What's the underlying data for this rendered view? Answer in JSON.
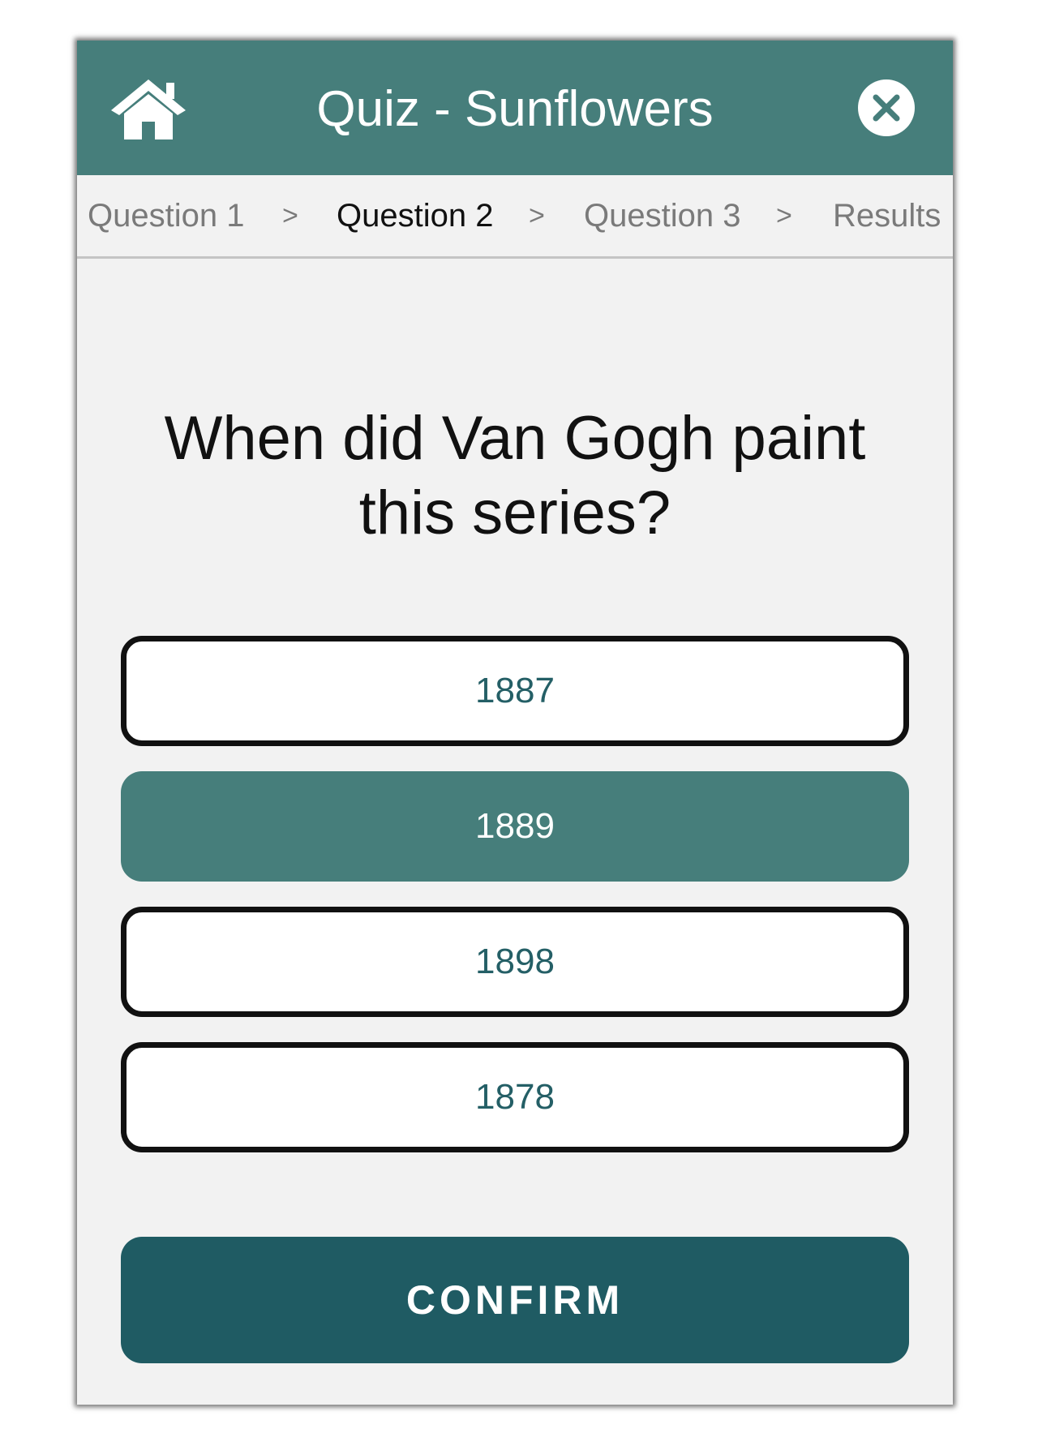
{
  "header": {
    "title": "Quiz - Sunflowers",
    "home_icon": "home-icon",
    "close_icon": "close-icon"
  },
  "steps": [
    {
      "label": "Question 1",
      "state": "done"
    },
    {
      "label": "Question 2",
      "state": "active"
    },
    {
      "label": "Question 3",
      "state": "upcoming"
    },
    {
      "label": "Results",
      "state": "upcoming"
    }
  ],
  "step_separator": ">",
  "question": {
    "line1": "When did Van Gogh paint",
    "line2": "this series?"
  },
  "options": [
    {
      "label": "1887",
      "selected": false
    },
    {
      "label": "1889",
      "selected": true
    },
    {
      "label": "1898",
      "selected": false
    },
    {
      "label": "1878",
      "selected": false
    }
  ],
  "confirm_label": "CONFIRM",
  "colors": {
    "header": "#467e7b",
    "selected_option": "#467e7b",
    "confirm_button": "#1f5b63",
    "option_text": "#245f66",
    "background": "#f2f2f2"
  }
}
